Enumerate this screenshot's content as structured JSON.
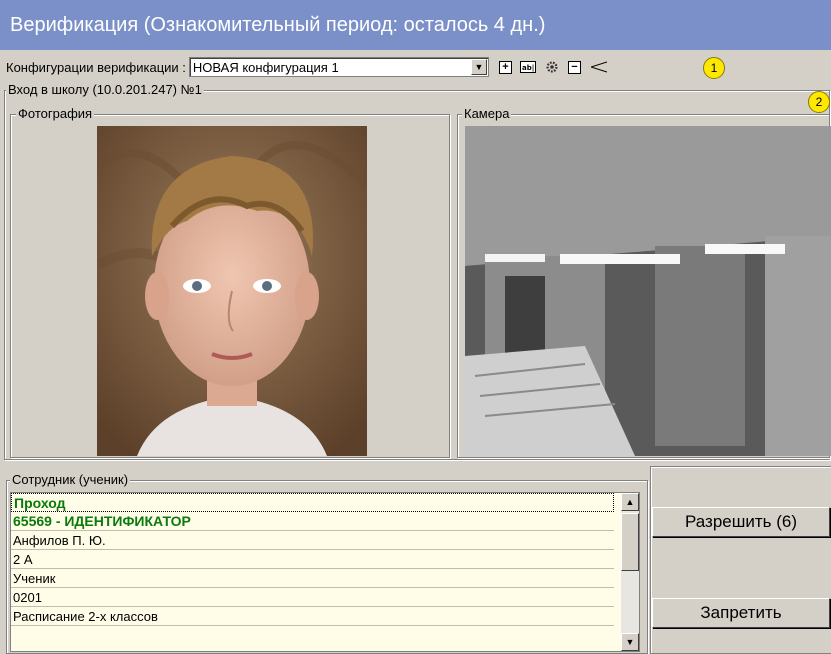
{
  "window": {
    "title": "Верификация (Ознакомительный период: осталось 4 дн.)"
  },
  "config": {
    "label": "Конфигурации верификации :",
    "selected": "НОВАЯ конфигурация 1",
    "buttons": [
      "add-icon",
      "rename-icon",
      "settings-icon",
      "remove-icon"
    ]
  },
  "callouts": {
    "one": "1",
    "two": "2"
  },
  "point": {
    "title": "Вход в школу (10.0.201.247) №1"
  },
  "photo_panel": {
    "label": "Фотография"
  },
  "camera_panel": {
    "label": "Камера"
  },
  "employee": {
    "label": "Сотрудник (ученик)",
    "rows": [
      "Проход",
      "65569 - ИДЕНТИФИКАТОР",
      "Анфилов П. Ю.",
      "2 А",
      "Ученик",
      "0201",
      "Расписание 2-х классов"
    ]
  },
  "actions": {
    "allow": "Разрешить (6)",
    "deny": "Запретить"
  },
  "colors": {
    "titlebar": "#7b90c8",
    "list_bg": "#fffde8",
    "green_text": "#0a7a0a",
    "callout": "#ffe800"
  }
}
